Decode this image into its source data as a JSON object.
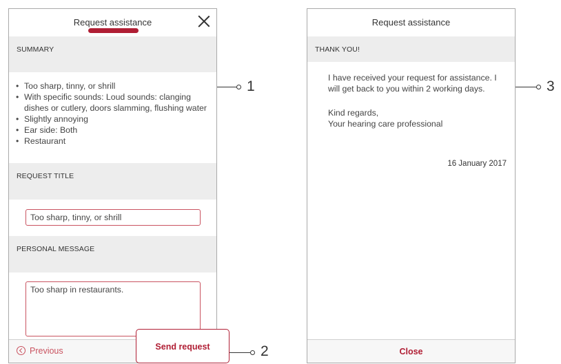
{
  "left_screen": {
    "title": "Request assistance",
    "summary_heading": "SUMMARY",
    "summary_items": [
      "Too sharp, tinny, or shrill",
      "With specific sounds: Loud sounds: clanging dishes or cutlery, doors slamming, flushing water",
      "Slightly annoying",
      "Ear side: Both",
      "Restaurant"
    ],
    "request_title_heading": "REQUEST TITLE",
    "request_title_value": "Too sharp, tinny, or shrill",
    "personal_message_heading": "PERSONAL MESSAGE",
    "personal_message_value": "Too sharp in restaurants.",
    "previous_label": "Previous",
    "send_label": "Send request"
  },
  "right_screen": {
    "title": "Request assistance",
    "thank_you_heading": "THANK YOU!",
    "message_line1": "I have received your request for assistance. I will get back to you within 2 working days.",
    "message_line2": "Kind regards,",
    "message_line3": "Your hearing care professional",
    "date": "16 January 2017",
    "close_label": "Close"
  },
  "callouts": {
    "c1": "1",
    "c2": "2",
    "c3": "3"
  },
  "colors": {
    "accent": "#b01e34",
    "field_border": "#c9525f",
    "band_background": "#ededed"
  },
  "icons": {
    "close": "close-icon",
    "previous": "chevron-left-circle-icon"
  }
}
